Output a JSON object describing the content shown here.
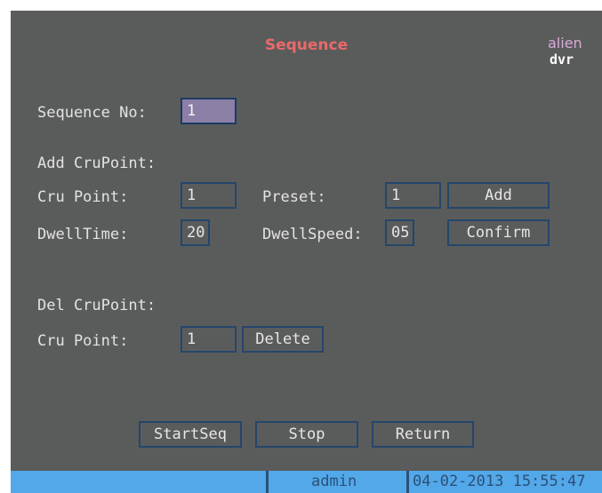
{
  "header": {
    "title": "Sequence",
    "logo_line1": "alien",
    "logo_line2": "dvr"
  },
  "sequence": {
    "label": "Sequence No:",
    "value": "1"
  },
  "add_cru_point": {
    "section_label": "Add CruPoint:",
    "cru_point_label": "Cru Point:",
    "cru_point_value": "1",
    "preset_label": "Preset:",
    "preset_value": "1",
    "add_button": "Add",
    "dwell_time_label": "DwellTime:",
    "dwell_time_value": "20",
    "dwell_speed_label": "DwellSpeed:",
    "dwell_speed_value": "05",
    "confirm_button": "Confirm"
  },
  "del_cru_point": {
    "section_label": "Del CruPoint:",
    "cru_point_label": "Cru Point:",
    "cru_point_value": "1",
    "delete_button": "Delete"
  },
  "footer_buttons": {
    "start_seq": "StartSeq",
    "stop": "Stop",
    "return": "Return"
  },
  "status_bar": {
    "user": "admin",
    "datetime": "04-02-2013 15:55:47"
  },
  "colors": {
    "background": "#5a5c5b",
    "title": "#e86a6a",
    "border": "#24466b",
    "selected_field": "#8b7fa6",
    "status_bar": "#52a8e8"
  }
}
